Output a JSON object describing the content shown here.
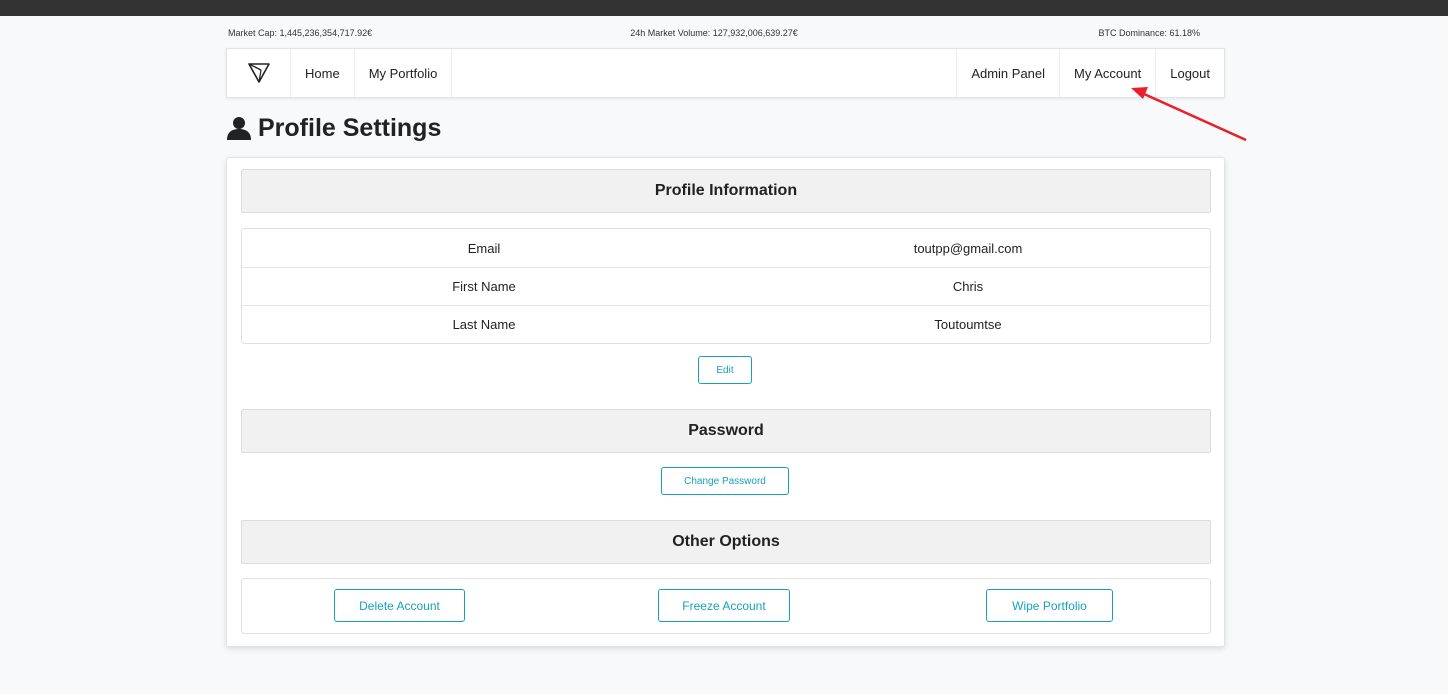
{
  "market": {
    "cap": "Market Cap: 1,445,236,354,717.92€",
    "volume": "24h Market Volume: 127,932,006,639.27€",
    "dominance": "BTC Dominance: 61.18%"
  },
  "nav": {
    "brand_icon": "triangle-logo-icon",
    "home": "Home",
    "portfolio": "My Portfolio",
    "admin": "Admin Panel",
    "account": "My Account",
    "logout": "Logout"
  },
  "page": {
    "title": "Profile Settings",
    "title_icon": "user-icon"
  },
  "profile": {
    "heading": "Profile Information",
    "rows": [
      {
        "label": "Email",
        "value": "toutpp@gmail.com"
      },
      {
        "label": "First Name",
        "value": "Chris"
      },
      {
        "label": "Last Name",
        "value": "Toutoumtse"
      }
    ],
    "edit_label": "Edit"
  },
  "password": {
    "heading": "Password",
    "change_label": "Change Password"
  },
  "options": {
    "heading": "Other Options",
    "delete_label": "Delete Account",
    "freeze_label": "Freeze Account",
    "wipe_label": "Wipe Portfolio"
  },
  "colors": {
    "accent": "#17a2b8",
    "annotation_arrow": "#e8202a",
    "topbar": "#333333"
  }
}
